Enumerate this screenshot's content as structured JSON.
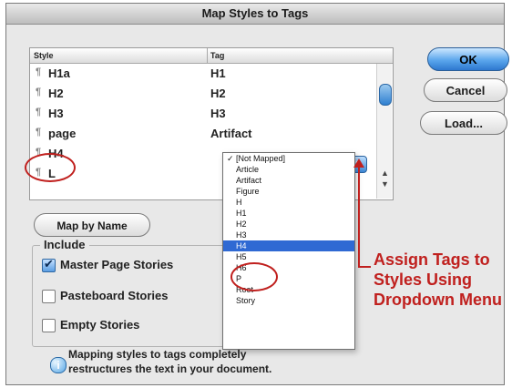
{
  "window": {
    "title": "Map Styles to Tags"
  },
  "table": {
    "headers": {
      "style": "Style",
      "tag": "Tag"
    },
    "rows": [
      {
        "style": "H1a",
        "tag": "H1"
      },
      {
        "style": "H2",
        "tag": "H2"
      },
      {
        "style": "H3",
        "tag": "H3"
      },
      {
        "style": "page",
        "tag": "Artifact"
      },
      {
        "style": "H4",
        "tag": ""
      },
      {
        "style": "L",
        "tag": ""
      }
    ],
    "paragraph_icon": "¶"
  },
  "buttons": {
    "ok": "OK",
    "cancel": "Cancel",
    "load": "Load...",
    "map_by_name": "Map by Name"
  },
  "include": {
    "label": "Include",
    "options": [
      {
        "label": "Master Page Stories",
        "checked": true
      },
      {
        "label": "Pasteboard Stories",
        "checked": false
      },
      {
        "label": "Empty Stories",
        "checked": false
      }
    ]
  },
  "info": {
    "icon": "info-icon",
    "text_line1": "Mapping styles to tags completely",
    "text_line2": "restructures the text in your document."
  },
  "dropdown": {
    "items": [
      "[Not Mapped]",
      "Article",
      "Artifact",
      "Figure",
      "H",
      "H1",
      "H2",
      "H3",
      "H4",
      "H5",
      "H6",
      "P",
      "Root",
      "Story"
    ],
    "checked_item": "[Not Mapped]",
    "highlighted_item": "H4"
  },
  "annotation": {
    "text": "Assign Tags to Styles Using Dropdown Menu",
    "color": "#c0201e"
  }
}
